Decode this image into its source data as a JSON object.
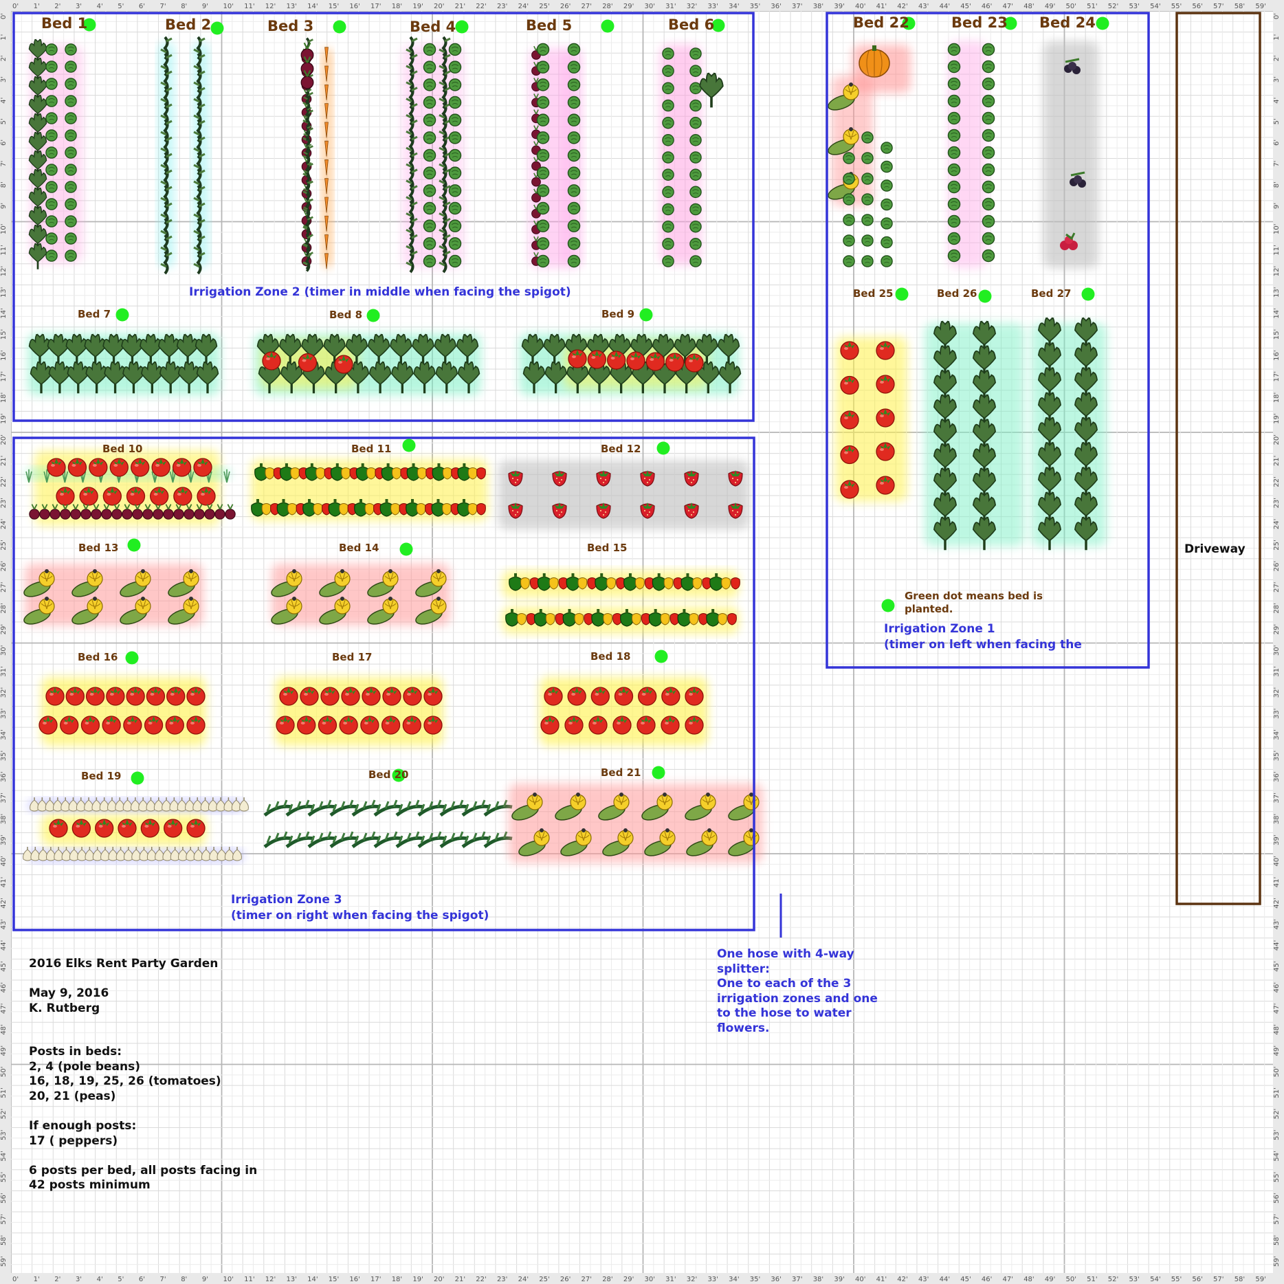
{
  "title": "2016  Elks Rent Party Garden",
  "date": "May 9, 2016",
  "author": "K. Rutberg",
  "notes": [
    "Posts in beds:",
    "2, 4 (pole beans)",
    "16, 18, 19, 25, 26 (tomatoes)",
    "20, 21 (peas)",
    "",
    "If enough posts:",
    "17 ( peppers)",
    "",
    "6 posts per bed, all posts facing in",
    "42 posts minimum"
  ],
  "zones": {
    "zone1": [
      "Irrigation Zone 1",
      "(timer on left when facing the"
    ],
    "zone2": "Irrigation Zone 2 (timer in middle when facing the spigot)",
    "zone3": [
      "Irrigation Zone 3",
      "(timer on right when facing the spigot)"
    ]
  },
  "legend": "Green dot means bed is planted.",
  "hose_note": [
    "One hose with 4-way",
    "splitter:",
    "One to each of the 3",
    "irrigation zones and one",
    "to the hose to water",
    "flowers."
  ],
  "driveway": "Driveway",
  "colors": {
    "zone": "#3434d8",
    "label": "#6b3a0e",
    "dot": "#21ee21",
    "driveway": "#5c3310"
  },
  "ruler_ticks": [
    "0'",
    "1'",
    "2'",
    "3'",
    "4'",
    "5'",
    "6'",
    "7'",
    "8'",
    "9'",
    "10'",
    "11'",
    "12'",
    "13'",
    "14'",
    "15'",
    "16'",
    "17'",
    "18'",
    "19'",
    "20'",
    "21'",
    "22'",
    "23'",
    "24'",
    "25'",
    "26'",
    "27'",
    "28'",
    "29'",
    "30'",
    "31'",
    "32'",
    "33'",
    "34'",
    "35'",
    "36'",
    "37'",
    "38'",
    "39'",
    "40'",
    "41'",
    "42'",
    "43'",
    "44'",
    "45'",
    "46'",
    "47'",
    "48'",
    "49'",
    "50'",
    "51'",
    "52'",
    "53'",
    "54'",
    "55'",
    "56'",
    "57'",
    "58'",
    "59'"
  ],
  "beds": [
    {
      "label": "Bed 1",
      "planted": true,
      "plants": [
        "kale"
      ]
    },
    {
      "label": "Bed 2",
      "planted": true,
      "plants": [
        "pole-bean"
      ]
    },
    {
      "label": "Bed 3",
      "planted": true,
      "plants": [
        "beet",
        "scallion",
        "carrot"
      ]
    },
    {
      "label": "Bed 4",
      "planted": true,
      "plants": [
        "pole-bean",
        "lettuce"
      ]
    },
    {
      "label": "Bed 5",
      "planted": true,
      "plants": [
        "beet",
        "lettuce"
      ]
    },
    {
      "label": "Bed 6",
      "planted": true,
      "plants": [
        "lettuce",
        "kale"
      ]
    },
    {
      "label": "Bed 7",
      "planted": true,
      "plants": [
        "kale"
      ]
    },
    {
      "label": "Bed 8",
      "planted": true,
      "plants": [
        "kale",
        "tomato"
      ]
    },
    {
      "label": "Bed 9",
      "planted": true,
      "plants": [
        "kale",
        "tomato"
      ]
    },
    {
      "label": "Bed 10",
      "planted": false,
      "plants": [
        "tomato",
        "onion",
        "beet"
      ]
    },
    {
      "label": "Bed 11",
      "planted": true,
      "plants": [
        "pepper"
      ]
    },
    {
      "label": "Bed 12",
      "planted": true,
      "plants": [
        "strawberry"
      ]
    },
    {
      "label": "Bed 13",
      "planted": true,
      "plants": [
        "squash"
      ]
    },
    {
      "label": "Bed 14",
      "planted": true,
      "plants": [
        "squash"
      ]
    },
    {
      "label": "Bed 15",
      "planted": false,
      "plants": [
        "pepper"
      ]
    },
    {
      "label": "Bed 16",
      "planted": true,
      "plants": [
        "tomato"
      ]
    },
    {
      "label": "Bed 17",
      "planted": false,
      "plants": [
        "tomato"
      ]
    },
    {
      "label": "Bed 18",
      "planted": true,
      "plants": [
        "tomato"
      ]
    },
    {
      "label": "Bed 19",
      "planted": true,
      "plants": [
        "garlic",
        "tomato"
      ]
    },
    {
      "label": "Bed 20",
      "planted": true,
      "plants": [
        "pea"
      ]
    },
    {
      "label": "Bed 21",
      "planted": true,
      "plants": [
        "squash"
      ]
    },
    {
      "label": "Bed 22",
      "planted": true,
      "plants": [
        "pumpkin",
        "squash",
        "lettuce"
      ]
    },
    {
      "label": "Bed 23",
      "planted": true,
      "plants": [
        "lettuce"
      ]
    },
    {
      "label": "Bed 24",
      "planted": true,
      "plants": [
        "blackberry",
        "raspberry"
      ]
    },
    {
      "label": "Bed 25",
      "planted": true,
      "plants": [
        "tomato"
      ]
    },
    {
      "label": "Bed 26",
      "planted": true,
      "plants": [
        "kale"
      ]
    },
    {
      "label": "Bed 27",
      "planted": true,
      "plants": [
        "kale"
      ]
    }
  ]
}
